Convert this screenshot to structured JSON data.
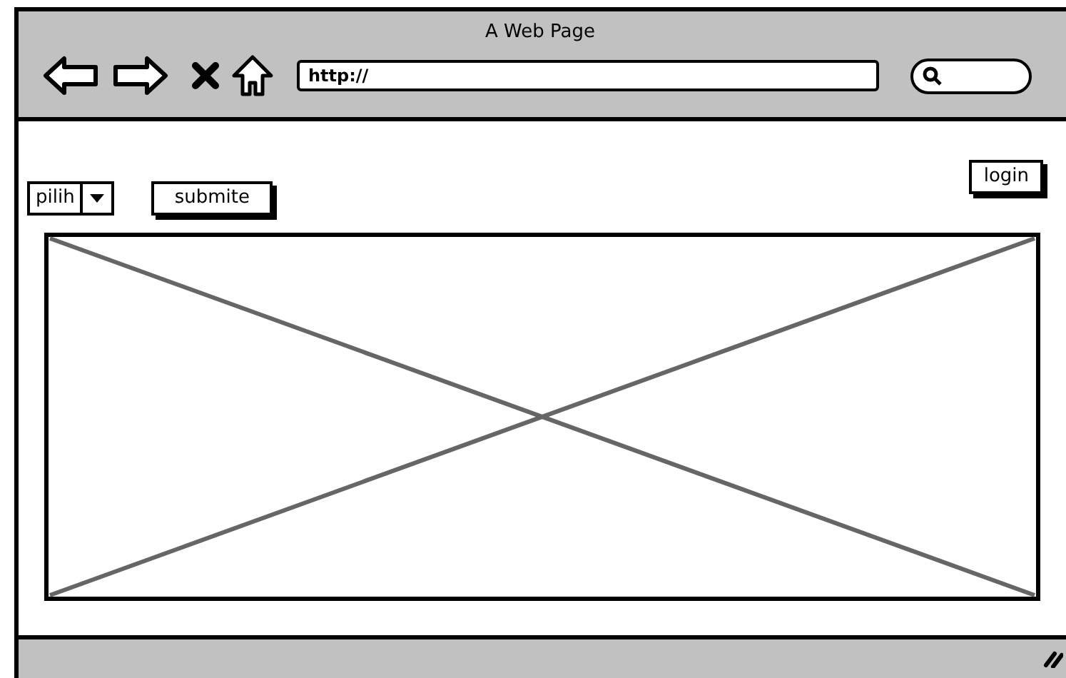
{
  "window": {
    "title": "A Web Page"
  },
  "address_bar": {
    "value": "http://"
  },
  "login_button": "login",
  "dropdown": {
    "value": "pilih"
  },
  "submit_button": "submite",
  "image": {
    "kind": "placeholder"
  }
}
